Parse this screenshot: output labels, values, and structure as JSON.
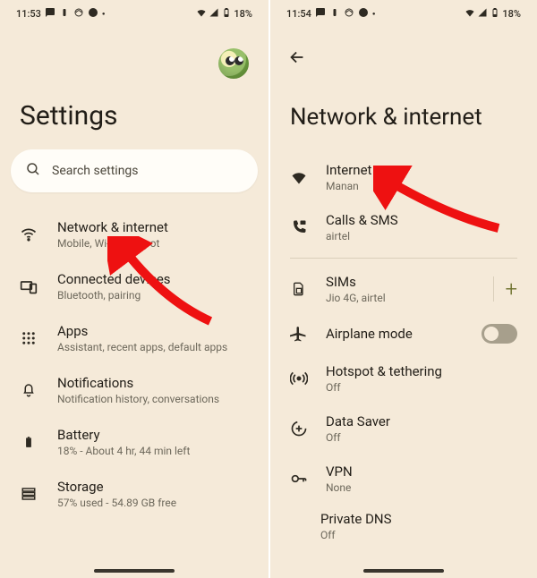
{
  "left": {
    "status": {
      "time": "11:53",
      "battery": "18%"
    },
    "title": "Settings",
    "search_placeholder": "Search settings",
    "items": [
      {
        "icon": "wifi",
        "title": "Network & internet",
        "sub": "Mobile, Wi-Fi, hotspot"
      },
      {
        "icon": "devices",
        "title": "Connected devices",
        "sub": "Bluetooth, pairing"
      },
      {
        "icon": "apps",
        "title": "Apps",
        "sub": "Assistant, recent apps, default apps"
      },
      {
        "icon": "bell",
        "title": "Notifications",
        "sub": "Notification history, conversations"
      },
      {
        "icon": "battery",
        "title": "Battery",
        "sub": "18% - About 4 hr, 44 min left"
      },
      {
        "icon": "storage",
        "title": "Storage",
        "sub": "57% used - 54.89 GB free"
      }
    ]
  },
  "right": {
    "status": {
      "time": "11:54",
      "battery": "18%"
    },
    "title": "Network & internet",
    "items": [
      {
        "icon": "wifi-solid",
        "title": "Internet",
        "sub": "Manan"
      },
      {
        "icon": "phone",
        "title": "Calls & SMS",
        "sub": "airtel"
      },
      {
        "icon": "sim",
        "title": "SIMs",
        "sub": "Jio 4G, airtel",
        "trail": "plus"
      },
      {
        "icon": "plane",
        "title": "Airplane mode",
        "sub": "",
        "trail": "toggle"
      },
      {
        "icon": "hotspot",
        "title": "Hotspot & tethering",
        "sub": "Off"
      },
      {
        "icon": "datasaver",
        "title": "Data Saver",
        "sub": "Off"
      },
      {
        "icon": "key",
        "title": "VPN",
        "sub": "None"
      }
    ],
    "partial": {
      "title": "Private DNS",
      "sub": "Off"
    }
  }
}
